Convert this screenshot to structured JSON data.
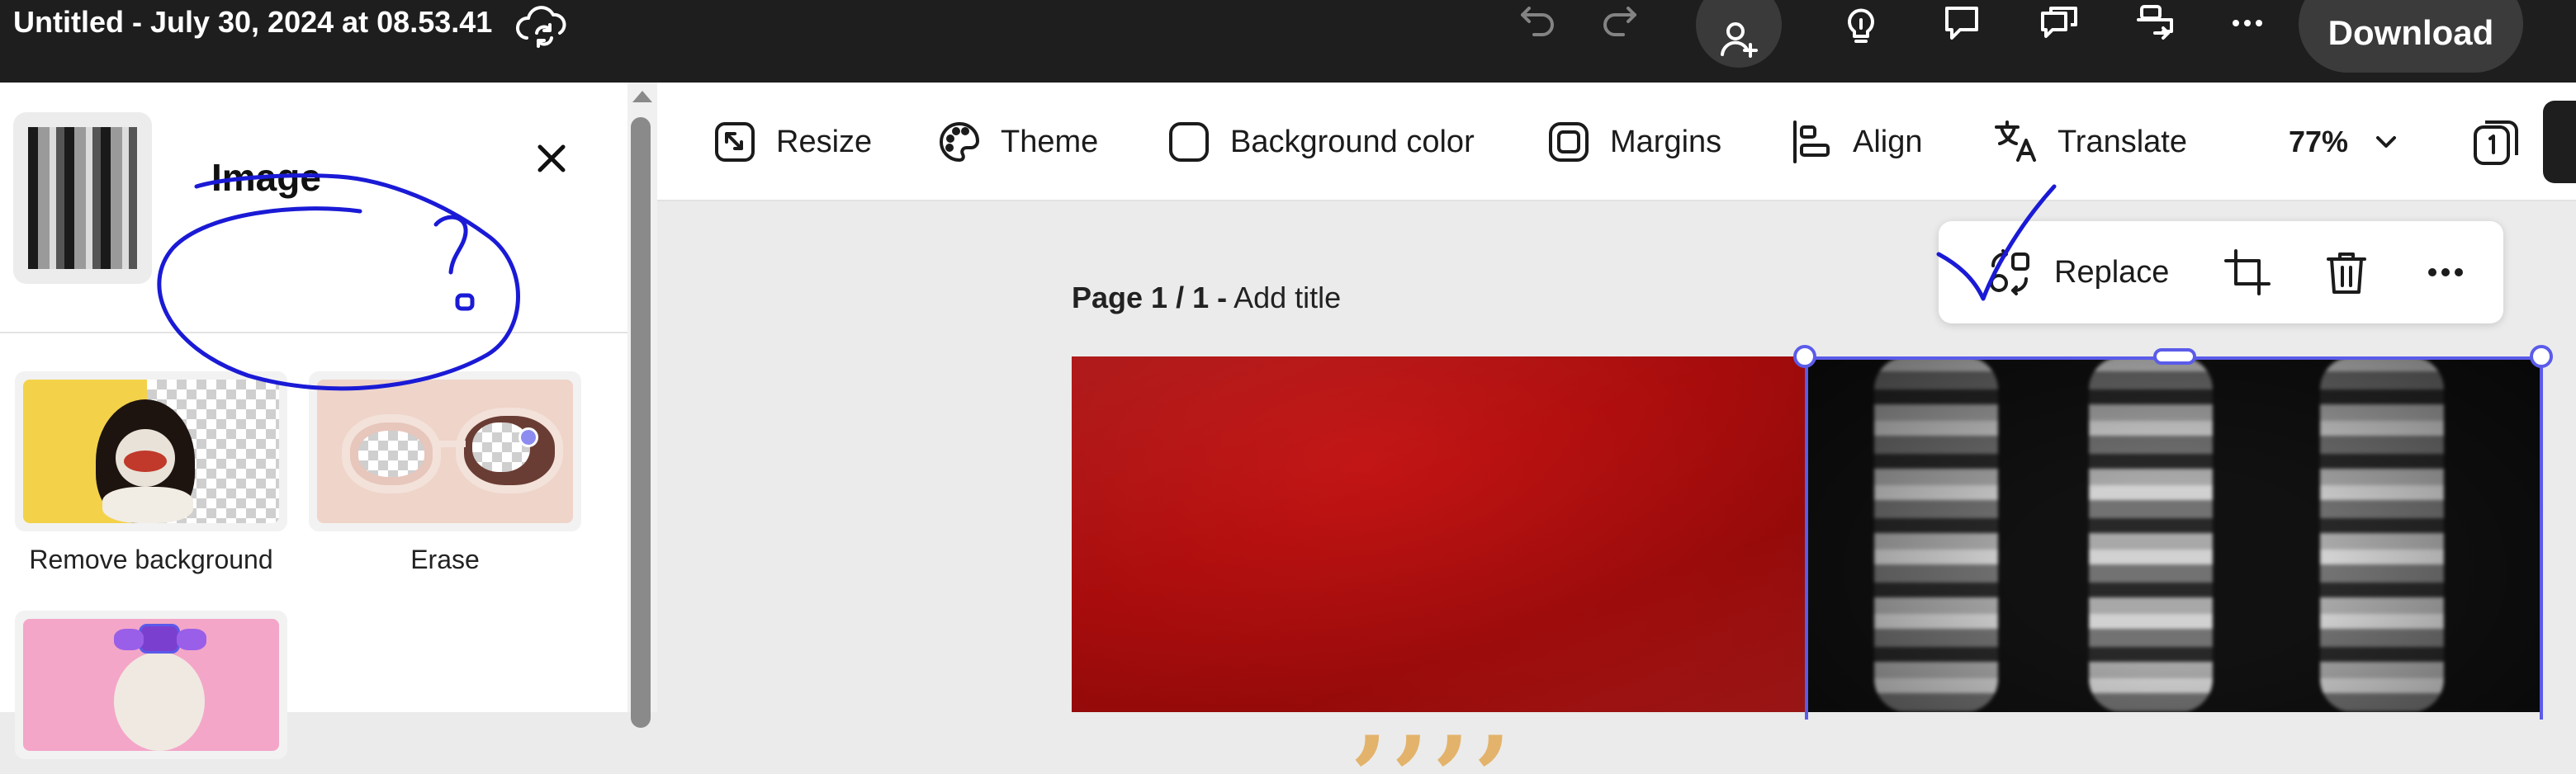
{
  "topbar": {
    "doc_title": "Untitled - July 30, 2024 at 08.53.41",
    "download_label": "Download",
    "icons": [
      "cloud-sync-icon",
      "undo-icon",
      "redo-icon",
      "invite-user-icon",
      "lightbulb-icon",
      "comment-icon",
      "chat-icon",
      "share-icon",
      "more-icon"
    ]
  },
  "panel": {
    "title": "Image",
    "tiles": [
      {
        "label": "Remove background"
      },
      {
        "label": "Erase"
      },
      {
        "label": ""
      }
    ]
  },
  "toolbar": {
    "tools": [
      {
        "label": "Resize",
        "icon": "resize-icon"
      },
      {
        "label": "Theme",
        "icon": "palette-icon"
      },
      {
        "label": "Background color",
        "icon": "background-color-icon"
      },
      {
        "label": "Margins",
        "icon": "margins-icon"
      },
      {
        "label": "Align",
        "icon": "align-icon"
      },
      {
        "label": "Translate",
        "icon": "translate-icon"
      }
    ],
    "zoom": "77%"
  },
  "canvas": {
    "page_number": "Page 1 / 1 -",
    "add_title": "Add title",
    "context_menu": {
      "replace_label": "Replace"
    }
  },
  "colors": {
    "topbar": "#1e1e1e",
    "selection": "#5b5bea",
    "annotation_ink": "#1a1ad6",
    "page_red": "#b00d0d",
    "accent_gold": "#e3b36b"
  }
}
